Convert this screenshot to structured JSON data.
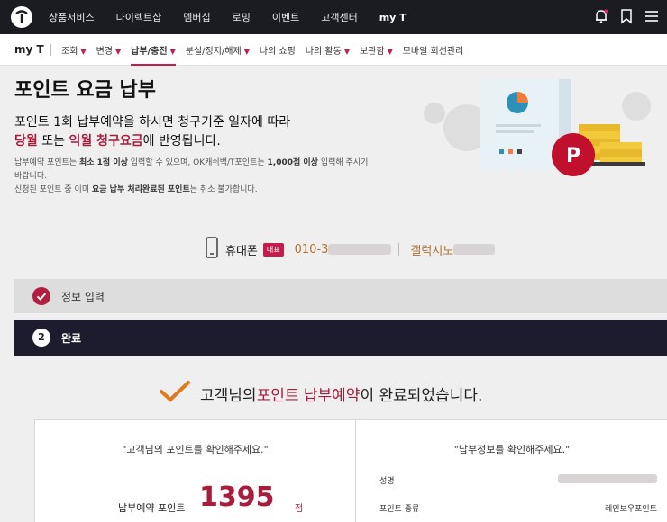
{
  "top_nav": {
    "items": [
      "상품서비스",
      "다이렉트샵",
      "멤버십",
      "로밍",
      "이벤트",
      "고객센터",
      "my T"
    ],
    "active": "my T"
  },
  "sub_nav": {
    "title": "my T",
    "items": [
      {
        "label": "조회",
        "caret": true
      },
      {
        "label": "변경",
        "caret": true
      },
      {
        "label": "납부/충전",
        "caret": true,
        "active": true
      },
      {
        "label": "분실/정지/해제",
        "caret": true
      },
      {
        "label": "나의 쇼핑",
        "caret": false
      },
      {
        "label": "나의 활동",
        "caret": true
      },
      {
        "label": "보관함",
        "caret": true
      },
      {
        "label": "모바일 회선관리",
        "caret": false
      }
    ]
  },
  "page": {
    "headline": "포인트 요금 납부",
    "lead_line1": "포인트 1회 납부예약을 하시면 청구기준 일자에 따라",
    "lead_line2_a": "당월",
    "lead_line2_b": " 또는 ",
    "lead_line2_c": "익월 청구요금",
    "lead_line2_d": "에 반영됩니다.",
    "note1_a": "납부예약 포인트는 ",
    "note1_b": "최소 1점 이상",
    "note1_c": " 입력할 수 있으며, OK캐쉬백/T포인트는 ",
    "note1_d": "1,000점 이상",
    "note1_e": " 입력해 주시기",
    "note1_f": "바랍니다.",
    "note2_a": "신청된 포인트 중 이미 ",
    "note2_b": "요금 납부 처리완료된 포인트",
    "note2_c": "는 취소 불가합니다."
  },
  "device": {
    "label": "휴대폰",
    "badge": "대표",
    "number_visible": "010-3",
    "model_visible": "갤럭시노"
  },
  "steps": [
    {
      "num": "✔",
      "label": "정보 입력",
      "state": "done"
    },
    {
      "num": "2",
      "label": "완료",
      "state": "active"
    }
  ],
  "completion": {
    "a": "고객님의 ",
    "b": "포인트 납부예약",
    "c": "이 완료되었습니다."
  },
  "left_panel": {
    "question": "\"고객님의 포인트를 확인해주세요.\"",
    "points_label": "납부예약 포인트",
    "points_value": "1395",
    "points_unit": "점"
  },
  "right_panel": {
    "question": "\"납부정보를 확인해주세요.\"",
    "rows": [
      {
        "label": "성명",
        "value": ""
      },
      {
        "label": "포인트 종류",
        "value": "레인보우포인트"
      }
    ]
  },
  "colors": {
    "accent": "#c41c4d",
    "dark_bar": "#1c1c2e",
    "brand_red": "#a81d3b"
  }
}
